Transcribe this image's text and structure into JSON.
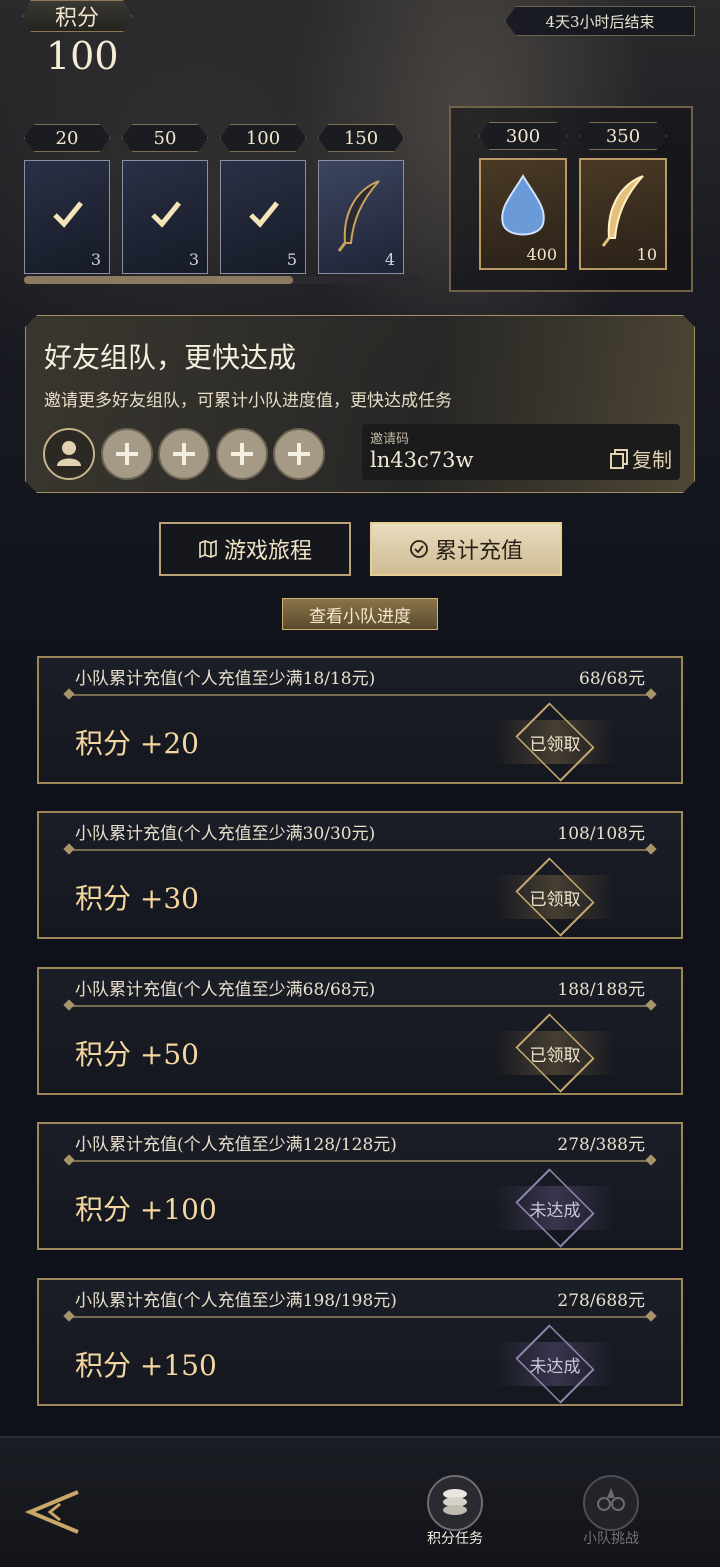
{
  "header": {
    "points_label": "积分",
    "points_value": "100",
    "timer": "4天3小时后结束"
  },
  "milestones": [
    {
      "cost": "20",
      "count": "3",
      "icon": "treasure-chest-icon",
      "claimed": true
    },
    {
      "cost": "50",
      "count": "3",
      "icon": "treasure-chest-icon",
      "claimed": true
    },
    {
      "cost": "100",
      "count": "5",
      "icon": "treasure-chest-icon",
      "claimed": true
    },
    {
      "cost": "150",
      "count": "4",
      "icon": "dark-feather-icon",
      "claimed": false
    }
  ],
  "milestone_progress": 0.68,
  "bonus_rewards": [
    {
      "cost": "300",
      "count": "400",
      "icon": "blue-crystal-icon"
    },
    {
      "cost": "350",
      "count": "10",
      "icon": "golden-feather-icon"
    }
  ],
  "team": {
    "title": "好友组队，更快达成",
    "subtitle": "邀请更多好友组队，可累计小队进度值，更快达成任务",
    "invite_label": "邀请码",
    "invite_code": "ln43c73w",
    "copy_label": "复制",
    "empty_slots": 4
  },
  "tabs": {
    "journey": "游戏旅程",
    "recharge": "累计充值",
    "active": "recharge"
  },
  "team_progress_button": "查看小队进度",
  "tasks": [
    {
      "desc": "小队累计充值(个人充值至少满18/18元)",
      "progress": "68/68元",
      "reward": "积分 +20",
      "status": "已领取",
      "claimed": true
    },
    {
      "desc": "小队累计充值(个人充值至少满30/30元)",
      "progress": "108/108元",
      "reward": "积分 +30",
      "status": "已领取",
      "claimed": true
    },
    {
      "desc": "小队累计充值(个人充值至少满68/68元)",
      "progress": "188/188元",
      "reward": "积分 +50",
      "status": "已领取",
      "claimed": true
    },
    {
      "desc": "小队累计充值(个人充值至少满128/128元)",
      "progress": "278/388元",
      "reward": "积分 +100",
      "status": "未达成",
      "claimed": false
    },
    {
      "desc": "小队累计充值(个人充值至少满198/198元)",
      "progress": "278/688元",
      "reward": "积分 +150",
      "status": "未达成",
      "claimed": false
    }
  ],
  "nav": {
    "points_tasks": "积分任务",
    "team_challenge": "小队挑战",
    "active": "points_tasks"
  },
  "colors": {
    "accent_gold": "#e9c88a",
    "claimed_text": "#f0e6d0",
    "unmet_text": "#c9c6d9"
  }
}
